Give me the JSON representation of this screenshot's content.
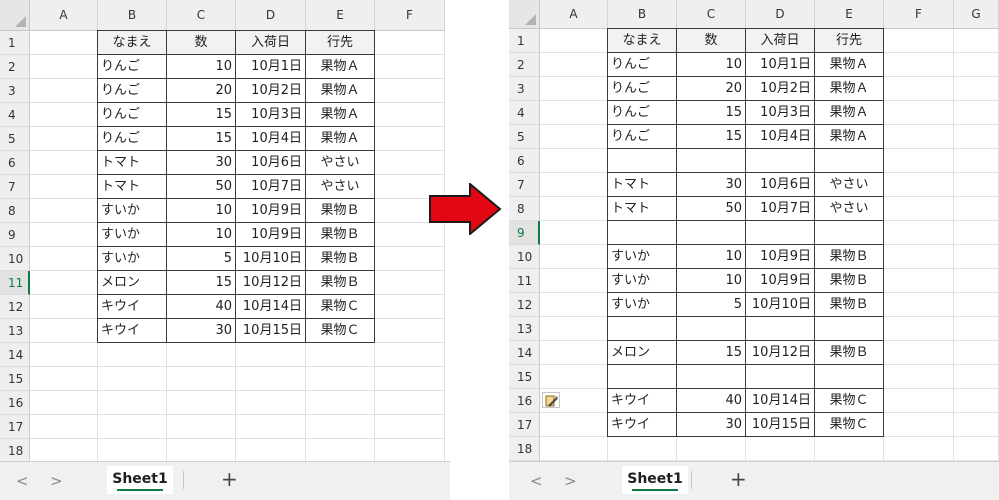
{
  "left": {
    "columns": [
      "A",
      "B",
      "C",
      "D",
      "E",
      "F"
    ],
    "row_numbers": [
      "1",
      "2",
      "3",
      "4",
      "5",
      "6",
      "7",
      "8",
      "9",
      "10",
      "11",
      "12",
      "13",
      "14",
      "15",
      "16",
      "17",
      "18"
    ],
    "active_row": 11,
    "header": [
      "なまえ",
      "数",
      "入荷日",
      "行先"
    ],
    "rows": [
      [
        "りんご",
        "10",
        "10月1日",
        "果物Ａ"
      ],
      [
        "りんご",
        "20",
        "10月2日",
        "果物Ａ"
      ],
      [
        "りんご",
        "15",
        "10月3日",
        "果物Ａ"
      ],
      [
        "りんご",
        "15",
        "10月4日",
        "果物Ａ"
      ],
      [
        "トマト",
        "30",
        "10月6日",
        "やさい"
      ],
      [
        "トマト",
        "50",
        "10月7日",
        "やさい"
      ],
      [
        "すいか",
        "10",
        "10月9日",
        "果物Ｂ"
      ],
      [
        "すいか",
        "10",
        "10月9日",
        "果物Ｂ"
      ],
      [
        "すいか",
        "5",
        "10月10日",
        "果物Ｂ"
      ],
      [
        "メロン",
        "15",
        "10月12日",
        "果物Ｂ"
      ],
      [
        "キウイ",
        "40",
        "10月14日",
        "果物Ｃ"
      ],
      [
        "キウイ",
        "30",
        "10月15日",
        "果物Ｃ"
      ]
    ]
  },
  "right": {
    "columns": [
      "A",
      "B",
      "C",
      "D",
      "E",
      "F",
      "G"
    ],
    "row_numbers": [
      "1",
      "2",
      "3",
      "4",
      "5",
      "6",
      "7",
      "8",
      "9",
      "10",
      "11",
      "12",
      "13",
      "14",
      "15",
      "16",
      "17",
      "18"
    ],
    "active_row": 9,
    "header": [
      "なまえ",
      "数",
      "入荷日",
      "行先"
    ],
    "rows": [
      [
        "りんご",
        "10",
        "10月1日",
        "果物Ａ"
      ],
      [
        "りんご",
        "20",
        "10月2日",
        "果物Ａ"
      ],
      [
        "りんご",
        "15",
        "10月3日",
        "果物Ａ"
      ],
      [
        "りんご",
        "15",
        "10月4日",
        "果物Ａ"
      ],
      [
        "",
        "",
        "",
        ""
      ],
      [
        "トマト",
        "30",
        "10月6日",
        "やさい"
      ],
      [
        "トマト",
        "50",
        "10月7日",
        "やさい"
      ],
      [
        "",
        "",
        "",
        ""
      ],
      [
        "すいか",
        "10",
        "10月9日",
        "果物Ｂ"
      ],
      [
        "すいか",
        "10",
        "10月9日",
        "果物Ｂ"
      ],
      [
        "すいか",
        "5",
        "10月10日",
        "果物Ｂ"
      ],
      [
        "",
        "",
        "",
        ""
      ],
      [
        "メロン",
        "15",
        "10月12日",
        "果物Ｂ"
      ],
      [
        "",
        "",
        "",
        ""
      ],
      [
        "キウイ",
        "40",
        "10月14日",
        "果物Ｃ"
      ],
      [
        "キウイ",
        "30",
        "10月15日",
        "果物Ｃ"
      ]
    ],
    "paste_icon_row": 16
  },
  "tabbar": {
    "prev_label": "<",
    "next_label": ">",
    "sheet_tab": "Sheet1",
    "add_label": "+"
  },
  "icons": {
    "arrow": "right-arrow-icon",
    "paste": "paste-options-icon"
  },
  "colors": {
    "accent": "#107c41",
    "arrow_fill": "#e30613"
  }
}
